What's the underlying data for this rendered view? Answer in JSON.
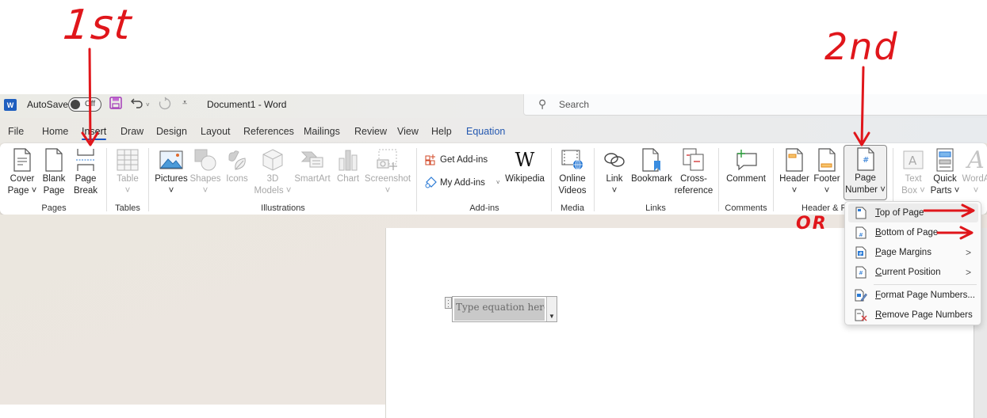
{
  "annotations": {
    "first": "1st",
    "second": "2nd",
    "or": "OR",
    "color": "#e0161b"
  },
  "titlebar": {
    "app_icon": "word-icon",
    "autosave_label": "AutoSave",
    "autosave_state": "Off",
    "save_icon": "save-icon",
    "undo_icon": "undo-icon",
    "redo_icon": "redo-icon",
    "customize_icon": "customize-quick-access-icon",
    "doc_title": "Document1  -  Word",
    "search_placeholder": "Search"
  },
  "tabs": [
    {
      "label": "File"
    },
    {
      "label": "Home"
    },
    {
      "label": "Insert",
      "active": true
    },
    {
      "label": "Draw"
    },
    {
      "label": "Design"
    },
    {
      "label": "Layout"
    },
    {
      "label": "References"
    },
    {
      "label": "Mailings"
    },
    {
      "label": "Review"
    },
    {
      "label": "View"
    },
    {
      "label": "Help"
    },
    {
      "label": "Equation",
      "contextual": true
    }
  ],
  "ribbon": {
    "groups": {
      "pages": "Pages",
      "tables": "Tables",
      "illustrations": "Illustrations",
      "addins": "Add-ins",
      "media": "Media",
      "links": "Links",
      "comments": "Comments",
      "header_footer": "Header & F"
    },
    "buttons": {
      "cover_page": [
        "Cover",
        "Page ˅"
      ],
      "blank_page": [
        "Blank",
        "Page"
      ],
      "page_break": [
        "Page",
        "Break"
      ],
      "table": [
        "Table",
        "˅"
      ],
      "pictures": [
        "Pictures",
        "˅"
      ],
      "shapes": [
        "Shapes",
        "˅"
      ],
      "icons": [
        "Icons",
        ""
      ],
      "models3d": [
        "3D",
        "Models ˅"
      ],
      "smartart": [
        "SmartArt",
        ""
      ],
      "chart": [
        "Chart",
        ""
      ],
      "screenshot": [
        "Screenshot",
        "˅"
      ],
      "get_addins": "Get Add-ins",
      "my_addins": "My Add-ins",
      "wikipedia": "Wikipedia",
      "online_videos": [
        "Online",
        "Videos"
      ],
      "link": [
        "Link",
        "˅"
      ],
      "bookmark": [
        "Bookmark",
        ""
      ],
      "cross_reference": [
        "Cross-",
        "reference"
      ],
      "comment": [
        "Comment",
        ""
      ],
      "header": [
        "Header",
        "˅"
      ],
      "footer": [
        "Footer",
        "˅"
      ],
      "page_number": [
        "Page",
        "Number ˅"
      ],
      "text_box": [
        "Text",
        "Box ˅"
      ],
      "quick_parts": [
        "Quick",
        "Parts ˅"
      ],
      "wordart": [
        "WordA",
        "˅"
      ]
    }
  },
  "document": {
    "equation_placeholder": "Type equation here."
  },
  "page_number_menu": {
    "items": [
      {
        "label": "Top of Page",
        "icon": "top-of-page-icon",
        "submenu": true
      },
      {
        "label": "Bottom of Page",
        "icon": "bottom-of-page-icon",
        "submenu": true
      },
      {
        "label": "Page Margins",
        "icon": "page-margins-icon",
        "submenu": true
      },
      {
        "label": "Current Position",
        "icon": "current-position-icon",
        "submenu": true
      },
      {
        "label": "Format Page Numbers...",
        "icon": "format-page-numbers-icon",
        "submenu": false
      },
      {
        "label": "Remove Page Numbers",
        "icon": "remove-page-numbers-icon",
        "submenu": false
      }
    ],
    "chevron": ">"
  }
}
